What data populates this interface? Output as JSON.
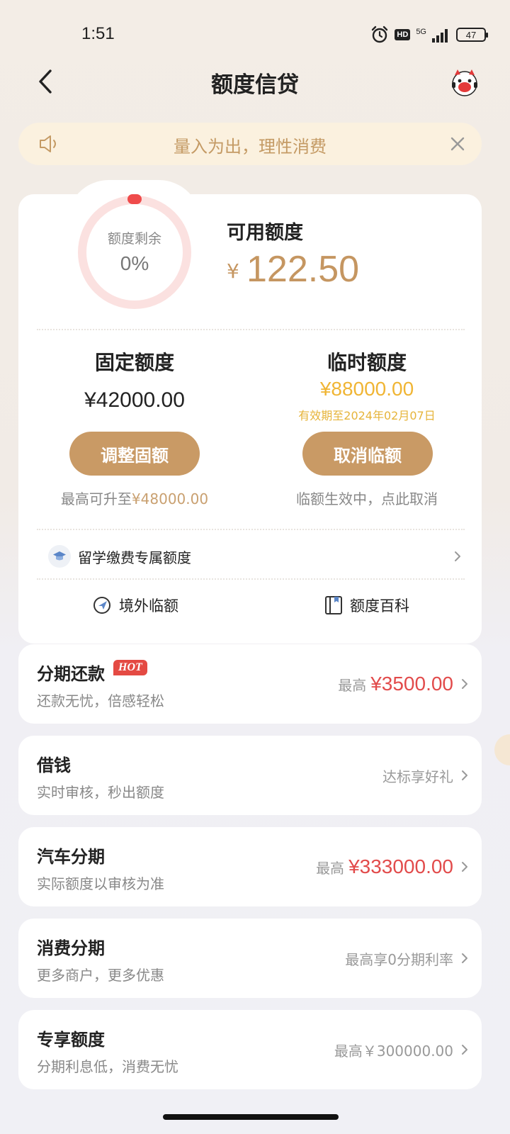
{
  "status_bar": {
    "time": "1:51",
    "hd": "HD",
    "network": "5G",
    "battery": "47"
  },
  "nav": {
    "title": "额度信贷",
    "back_icon": "chevron-left-icon",
    "mascot_icon": "mascot-icon"
  },
  "notice": {
    "text": "量入为出，理性消费"
  },
  "credit": {
    "ring_label": "额度剩余",
    "ring_value": "0%",
    "ring_fraction": 0,
    "available_label": "可用额度",
    "currency": "¥",
    "available_amount": "122.50"
  },
  "fixed": {
    "title": "固定额度",
    "amount": "¥42000.00",
    "button": "调整固额",
    "hint_prefix": "最高可升至",
    "hint_amount": "¥48000.00"
  },
  "temporary": {
    "title": "临时额度",
    "amount": "¥88000.00",
    "expiry": "有效期至2024年02月07日",
    "button": "取消临额",
    "hint": "临额生效中，点此取消"
  },
  "study": {
    "label": "留学缴费专属额度"
  },
  "links": {
    "overseas": "境外临额",
    "wiki": "额度百科"
  },
  "products": {
    "installment": {
      "title": "分期还款",
      "badge": "HOT",
      "subtitle": "还款无忧，倍感轻松",
      "prefix": "最高",
      "amount": "¥3500.00"
    },
    "borrow": {
      "title": "借钱",
      "subtitle": "实时审核，秒出额度",
      "right": "达标享好礼"
    },
    "car": {
      "title": "汽车分期",
      "subtitle": "实际额度以审核为准",
      "prefix": "最高",
      "amount": "¥333000.00"
    },
    "consumer": {
      "title": "消费分期",
      "subtitle": "更多商户，更多优惠",
      "right": "最高享0分期利率"
    },
    "exclusive": {
      "title": "专享额度",
      "subtitle": "分期利息低，消费无忧",
      "right": "最高￥300000.00"
    }
  },
  "colors": {
    "gold": "#c99a65",
    "red": "#e24b4b",
    "amber": "#f0b534"
  }
}
